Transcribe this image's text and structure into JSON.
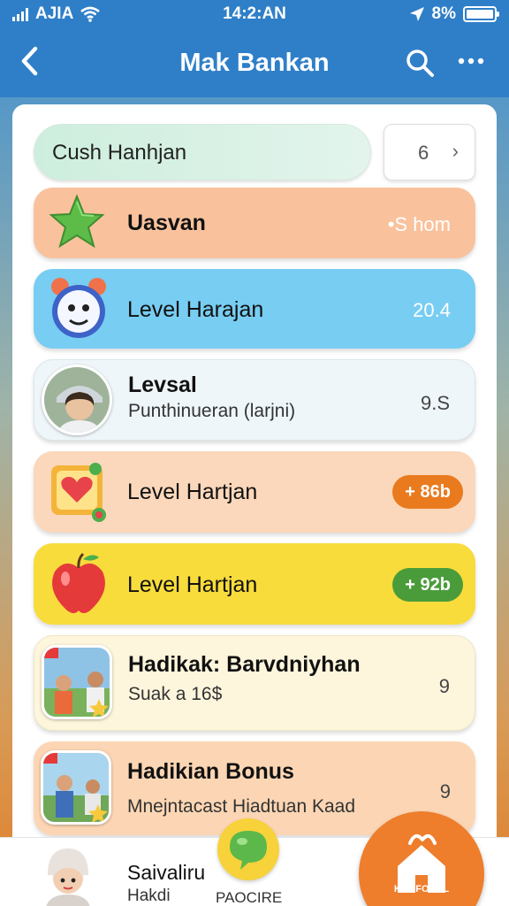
{
  "status": {
    "carrier": "AJIA",
    "time": "14:2:AN",
    "battery": "8%"
  },
  "appbar": {
    "title": "Mak Bankan"
  },
  "search": {
    "value": "Cush Hanhjan",
    "page": "6"
  },
  "cards": [
    {
      "title": "Uasvan",
      "value": "•S hom",
      "color": "#f8c7a2",
      "icon": "star-icon"
    },
    {
      "title": "Level Harajan",
      "value": "20.4",
      "color": "#7fd1f3",
      "icon": "alarm-clock-icon"
    },
    {
      "title": "Levsal",
      "subtitle": "Punthinueran (larjni)",
      "value": "9.S",
      "color": "#eef6fa",
      "icon": "avatar"
    },
    {
      "title": "Level Hartjan",
      "badge": "+ 86b",
      "badge_color": "#e97a1e",
      "color": "#fbd9bd",
      "icon": "heart-frame-icon"
    },
    {
      "title": "Level Hartjan",
      "badge": "+ 92b",
      "badge_color": "#4a9c3a",
      "color": "#f8dc3c",
      "icon": "apple-icon"
    },
    {
      "title": "Hadikak: Barvdniyhan",
      "subtitle": "Suak a 16$",
      "value": "9",
      "color": "#fdf6dc",
      "icon": "photo"
    },
    {
      "title": "Hadikian Bonus",
      "subtitle": "Mnejntacast Hiadtuan Kaad",
      "value": "9",
      "color": "#fcd7b6",
      "icon": "photo"
    }
  ],
  "bottom": {
    "name": "Saivaliru",
    "sub": "Hakdi",
    "green_label": "PAOCIRE",
    "orange_label": "KUGFOBAL"
  }
}
